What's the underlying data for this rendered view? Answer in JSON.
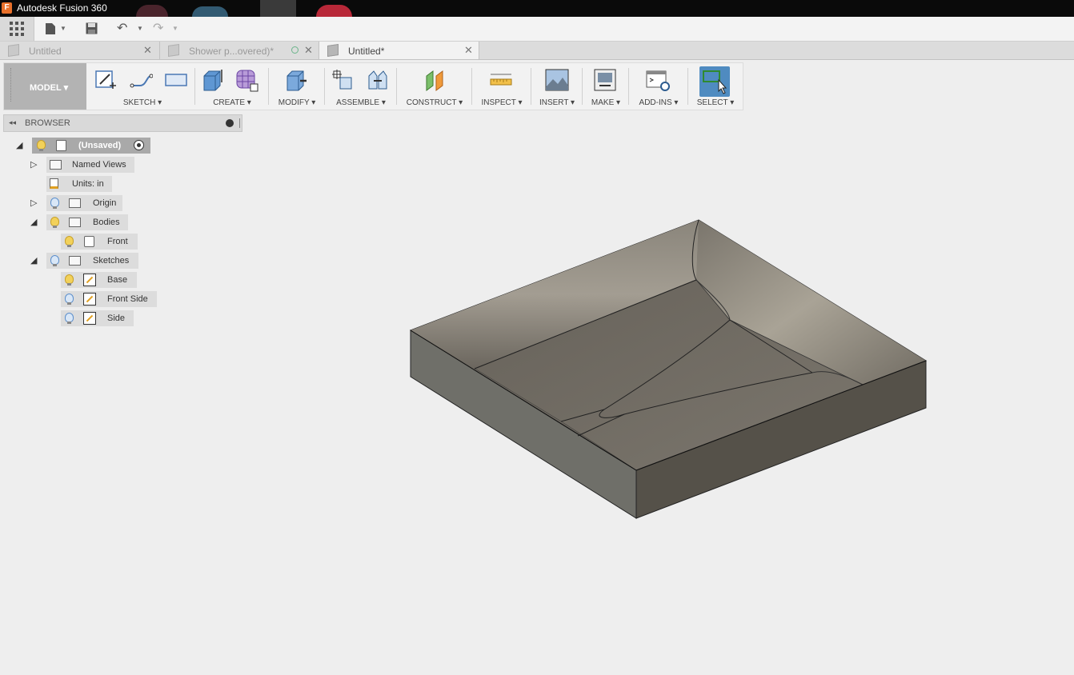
{
  "window": {
    "title": "Autodesk Fusion 360"
  },
  "tabs": [
    {
      "label": "Untitled",
      "active": false
    },
    {
      "label": "Shower p...overed)*",
      "active": false
    },
    {
      "label": "Untitled*",
      "active": true
    }
  ],
  "toolbar": {
    "workspace": "MODEL ▾",
    "groups": {
      "sketch": "SKETCH ▾",
      "create": "CREATE ▾",
      "modify": "MODIFY ▾",
      "assemble": "ASSEMBLE ▾",
      "construct": "CONSTRUCT ▾",
      "inspect": "INSPECT ▾",
      "insert": "INSERT ▾",
      "make": "MAKE ▾",
      "addins": "ADD-INS ▾",
      "select": "SELECT ▾"
    }
  },
  "browser": {
    "title": "BROWSER",
    "root": "(Unsaved)",
    "items": {
      "named_views": "Named Views",
      "units": "Units: in",
      "origin": "Origin",
      "bodies": "Bodies",
      "front_body": "Front",
      "sketches": "Sketches",
      "sketch_base": "Base",
      "sketch_front_side": "Front Side",
      "sketch_side": "Side"
    }
  },
  "colors": {
    "select_active": "#4f8bc0",
    "bulb_on": "#f2d15a",
    "bulb_off": "#5b8ecb"
  }
}
